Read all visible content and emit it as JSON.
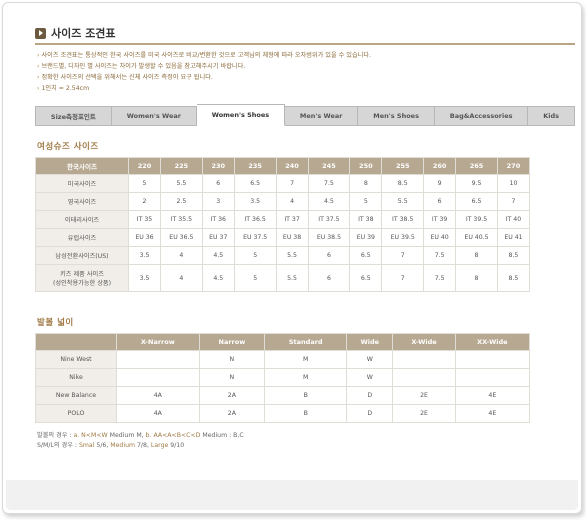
{
  "header": {
    "title": "사이즈 조견표"
  },
  "notes": [
    "사이즈 조견표는 통상적인 한국 사이즈를 미국 사이즈로 비교/변환한 것으로 고객님의 체형에 따라 오차범위가 있을 수 있습니다.",
    "브랜드별, 디자인 별 사이즈는 차이가 발생할 수 있음을 참고해주시기 바랍니다.",
    "정확한 사이즈의 선택을 위해서는 신체 사이즈 측정이 요구 됩니다.",
    "1인치 = 2.54cm"
  ],
  "tabs": [
    "Size측정포인트",
    "Women's Wear",
    "Women's Shoes",
    "Men's Wear",
    "Men's Shoes",
    "Bag&Accessories",
    "Kids"
  ],
  "active_tab": "Women's Shoes",
  "size_section": {
    "title": "여성슈즈 사이즈",
    "header_label": "한국사이즈",
    "columns": [
      "220",
      "225",
      "230",
      "235",
      "240",
      "245",
      "250",
      "255",
      "260",
      "265",
      "270"
    ],
    "rows": [
      {
        "label": "미국사이즈",
        "values": [
          "5",
          "5.5",
          "6",
          "6.5",
          "7",
          "7.5",
          "8",
          "8.5",
          "9",
          "9.5",
          "10"
        ]
      },
      {
        "label": "영국사이즈",
        "values": [
          "2",
          "2.5",
          "3",
          "3.5",
          "4",
          "4.5",
          "5",
          "5.5",
          "6",
          "6.5",
          "7"
        ]
      },
      {
        "label": "이태리사이즈",
        "values": [
          "IT 35",
          "IT 35.5",
          "IT 36",
          "IT 36.5",
          "IT 37",
          "IT 37.5",
          "IT 38",
          "IT 38.5",
          "IT 39",
          "IT 39.5",
          "IT 40"
        ]
      },
      {
        "label": "유럽사이즈",
        "values": [
          "EU 36",
          "EU 36.5",
          "EU 37",
          "EU 37.5",
          "EU 38",
          "EU 38.5",
          "EU 39",
          "EU 39.5",
          "EU 40",
          "EU 40.5",
          "EU 41"
        ]
      },
      {
        "label": "남성전환사이즈(US)",
        "values": [
          "3.5",
          "4",
          "4.5",
          "5",
          "5.5",
          "6",
          "6.5",
          "7",
          "7.5",
          "8",
          "8.5"
        ]
      },
      {
        "label": "키즈 제품 사이즈",
        "label2": "(성인착용가능한 상품)",
        "values": [
          "3.5",
          "4",
          "4.5",
          "5",
          "5.5",
          "6",
          "6.5",
          "7",
          "7.5",
          "8",
          "8.5"
        ]
      }
    ]
  },
  "width_section": {
    "title": "발볼 넓이",
    "columns": [
      "X-Narrow",
      "Narrow",
      "Standard",
      "Wide",
      "X-Wide",
      "XX-Wide"
    ],
    "rows": [
      {
        "label": "Nine West",
        "values": [
          "",
          "N",
          "M",
          "W",
          "",
          ""
        ]
      },
      {
        "label": "Nike",
        "values": [
          "",
          "N",
          "M",
          "W",
          "",
          ""
        ]
      },
      {
        "label": "New Balance",
        "values": [
          "4A",
          "2A",
          "B",
          "D",
          "2E",
          "4E"
        ]
      },
      {
        "label": "POLO",
        "values": [
          "4A",
          "2A",
          "B",
          "D",
          "2E",
          "4E"
        ]
      }
    ]
  },
  "footnotes": {
    "line1_prefix": "발볼의 경우 : ",
    "line1_a": "a. N<M<W",
    "line1_a_rest": " Medium M, ",
    "line1_b": "b. AA<A<B<C<D",
    "line1_b_rest": " Medium : B,C",
    "line2_prefix": "S/M/L의 경우 : ",
    "line2_small": "Smal",
    "line2_small_rest": " 5/6, ",
    "line2_medium": "Medium",
    "line2_medium_rest": " 7/8, ",
    "line2_large": "Large",
    "line2_large_rest": " 9/10"
  }
}
